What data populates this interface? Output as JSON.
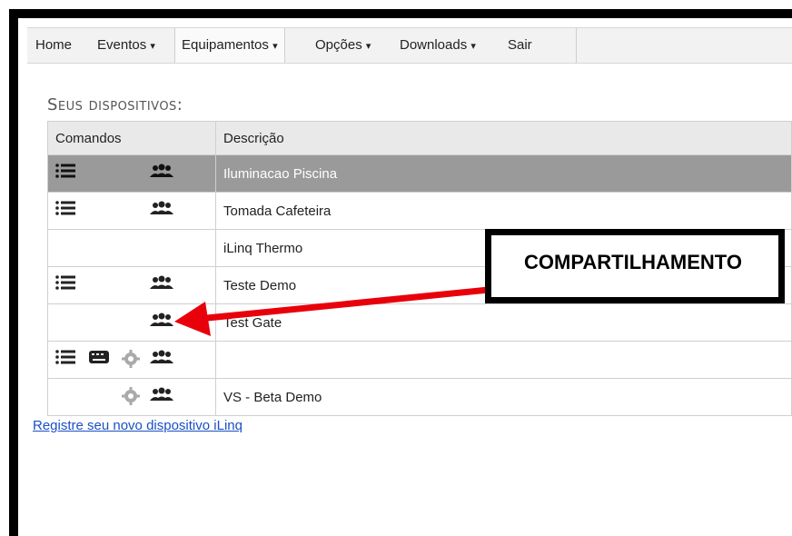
{
  "nav": {
    "items": [
      {
        "label": "Home",
        "caret": ""
      },
      {
        "label": "Eventos",
        "caret": "▾"
      },
      {
        "label": "Equipamentos",
        "caret": "▾"
      },
      {
        "label": "Opções",
        "caret": "▾"
      },
      {
        "label": "Downloads",
        "caret": "▾"
      },
      {
        "label": "Sair",
        "caret": ""
      }
    ],
    "active": "Equipamentos"
  },
  "section_title": "Seus dispositivos:",
  "table": {
    "headers": [
      "Comandos",
      "Descrição"
    ],
    "rows": [
      {
        "description": "Iluminacao Piscina",
        "icons": [
          "list-icon",
          "group-icon"
        ],
        "selected": true
      },
      {
        "description": "Tomada Cafeteira",
        "icons": [
          "list-icon",
          "group-icon"
        ],
        "selected": false
      },
      {
        "description": "iLinq Thermo",
        "icons": [],
        "selected": false
      },
      {
        "description": "Teste Demo",
        "icons": [
          "list-icon",
          "group-icon"
        ],
        "selected": false
      },
      {
        "description": "Test Gate",
        "icons": [
          "group-icon"
        ],
        "selected": false
      },
      {
        "description": "",
        "icons": [
          "list-icon",
          "keyboard-icon",
          "gear-icon",
          "group-icon"
        ],
        "selected": false
      },
      {
        "description": "VS - Beta Demo",
        "icons": [
          "gear-icon",
          "group-icon"
        ],
        "selected": false
      }
    ]
  },
  "register_link": "Registre seu novo dispositivo iLinq",
  "callout": "COMPARTILHAMENTO",
  "colors": {
    "selected_row": "#9a9a9a",
    "arrow": "#e8000b",
    "link": "#1a4fc5"
  }
}
